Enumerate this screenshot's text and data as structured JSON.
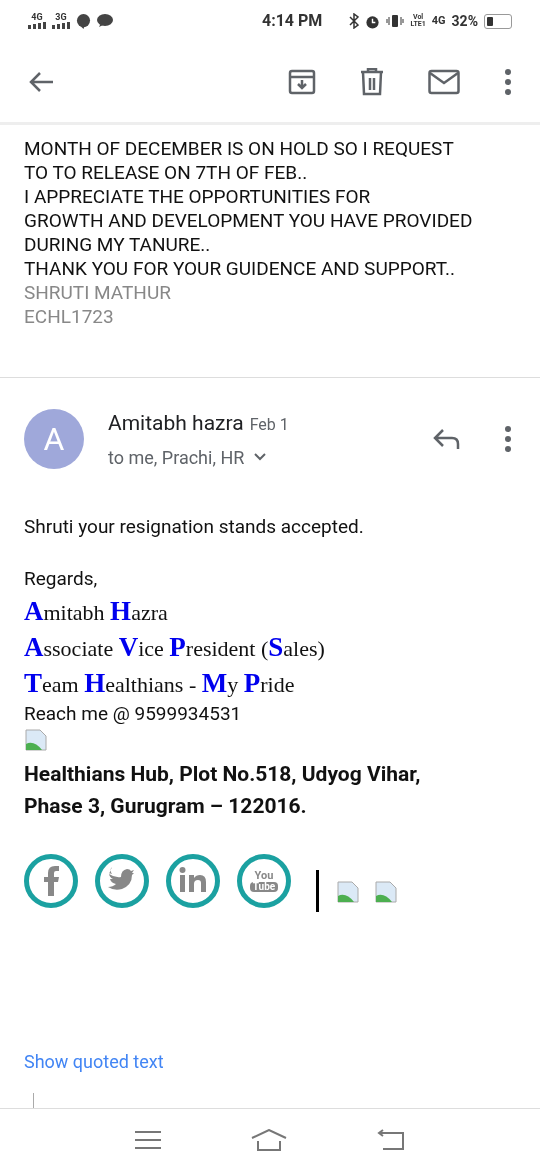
{
  "status_bar": {
    "left": [
      "4G",
      "3G"
    ],
    "time": "4:14 PM",
    "volte": [
      "Vol",
      "LTE1"
    ],
    "network": "4G",
    "battery": "32%"
  },
  "quoted_lines": [
    {
      "text": "MONTH OF DECEMBER IS ON HOLD SO I REQUEST",
      "muted": false
    },
    {
      "text": "TO TO RELEASE ON 7TH OF FEB..",
      "muted": false
    },
    {
      "text": "I APPRECIATE THE OPPORTUNITIES FOR",
      "muted": false
    },
    {
      "text": "GROWTH AND DEVELOPMENT YOU HAVE PROVIDED",
      "muted": false
    },
    {
      "text": "DURING MY TANURE..",
      "muted": false
    },
    {
      "text": "THANK YOU FOR YOUR GUIDENCE AND SUPPORT..",
      "muted": false
    },
    {
      "text": "SHRUTI MATHUR",
      "muted": true
    },
    {
      "text": "ECHL1723",
      "muted": true
    }
  ],
  "message": {
    "avatar": "A",
    "sender": "Amitabh hazra",
    "date": "Feb 1",
    "recipients": "to me, Prachi, HR",
    "body": "Shruti your resignation stands accepted.",
    "regards": "Regards,",
    "signature": [
      "**A**mitabh **H**azra",
      "**A**ssociate **V**ice **P**resident (**S**ales)",
      "**T**eam **H**ealthians - **M**y **P**ride"
    ],
    "reach": "Reach me @ 9599934531",
    "address": [
      "Healthians Hub, Plot No.518, Udyog Vihar,",
      "Phase 3, Gurugram – 122016."
    ],
    "social": [
      {
        "kind": "facebook"
      },
      {
        "kind": "twitter"
      },
      {
        "kind": "linkedin"
      },
      {
        "kind": "youtube",
        "label": [
          "You",
          "Tube"
        ]
      }
    ],
    "show_quoted": "Show quoted text"
  }
}
